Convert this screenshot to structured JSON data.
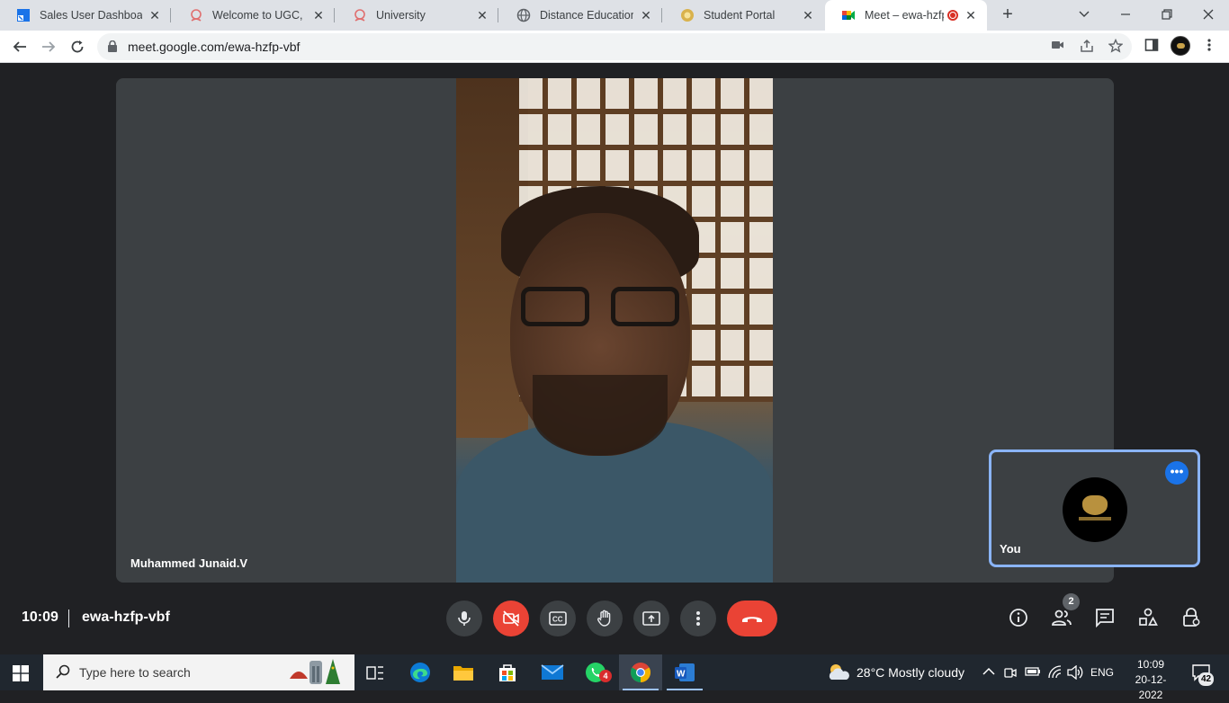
{
  "browser": {
    "tabs": [
      {
        "title": "Sales User Dashboard",
        "icon": "dashboard-favicon"
      },
      {
        "title": "Welcome to UGC, New",
        "icon": "ugc-favicon"
      },
      {
        "title": "University",
        "icon": "ugc-favicon"
      },
      {
        "title": "Distance Education Bu",
        "icon": "globe-favicon"
      },
      {
        "title": "Student Portal",
        "icon": "portal-favicon"
      },
      {
        "title": "Meet – ewa-hzfp-",
        "icon": "meet-favicon",
        "active": true
      }
    ],
    "url": "meet.google.com/ewa-hzfp-vbf"
  },
  "meet": {
    "participant_name": "Muhammed Junaid.V",
    "self_label": "You",
    "clock": "10:09",
    "meeting_code": "ewa-hzfp-vbf",
    "participant_count": "2",
    "accent_color": "#8ab4f8",
    "end_call_color": "#ea4335"
  },
  "taskbar": {
    "search_placeholder": "Type here to search",
    "whatsapp_badge": "4",
    "weather": "28°C  Mostly cloudy",
    "language": "ENG",
    "time": "10:09",
    "date": "20-12-2022",
    "notifications": "42"
  }
}
